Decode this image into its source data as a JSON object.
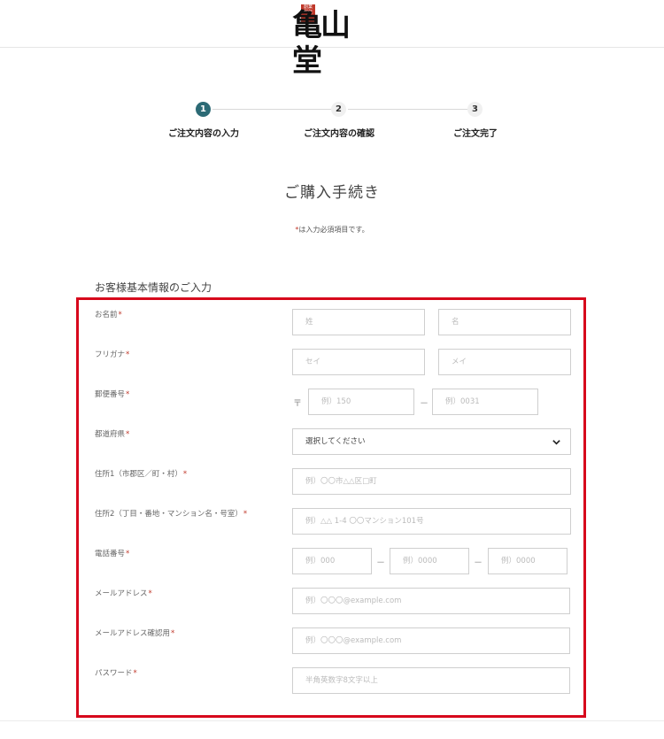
{
  "header": {
    "logo_alt": "亀山堂"
  },
  "steps": [
    {
      "number": "1",
      "label": "ご注文内容の入力",
      "active": true
    },
    {
      "number": "2",
      "label": "ご注文内容の確認",
      "active": false
    },
    {
      "number": "3",
      "label": "ご注文完了",
      "active": false
    }
  ],
  "page_title": "ご購入手続き",
  "required_note": {
    "star": "*",
    "text": "は入力必須項目です。"
  },
  "section_title": "お客様基本情報のご入力",
  "form": {
    "name": {
      "label": "お名前",
      "star": "*",
      "last_placeholder": "姓",
      "first_placeholder": "名"
    },
    "kana": {
      "label": "フリガナ",
      "star": "*",
      "last_placeholder": "セイ",
      "first_placeholder": "メイ"
    },
    "postal": {
      "label": "郵便番号",
      "star": "*",
      "prefix": "〒",
      "first_placeholder": "例）150",
      "dash": "－",
      "second_placeholder": "例）0031"
    },
    "prefecture": {
      "label": "都道府県",
      "star": "*",
      "selected": "選択してください"
    },
    "address1": {
      "label": "住所1（市郡区／町・村）",
      "star": "*",
      "placeholder": "例）〇〇市△△区□町"
    },
    "address2": {
      "label": "住所2（丁目・番地・マンション名・号室）",
      "star": "*",
      "placeholder": "例）△△ 1-4 〇〇マンション101号"
    },
    "phone": {
      "label": "電話番号",
      "star": "*",
      "placeholder1": "例）000",
      "placeholder2": "例）0000",
      "placeholder3": "例）0000",
      "dash": "－"
    },
    "email": {
      "label": "メールアドレス",
      "star": "*",
      "placeholder": "例）〇〇〇@example.com"
    },
    "email_confirm": {
      "label": "メールアドレス確認用",
      "star": "*",
      "placeholder": "例）〇〇〇@example.com"
    },
    "password": {
      "label": "パスワード",
      "star": "*",
      "placeholder": "半角英数字8文字以上"
    }
  },
  "colors": {
    "accent": "#2c6a75",
    "required": "#c0392b",
    "highlight_border": "#d7081c"
  }
}
